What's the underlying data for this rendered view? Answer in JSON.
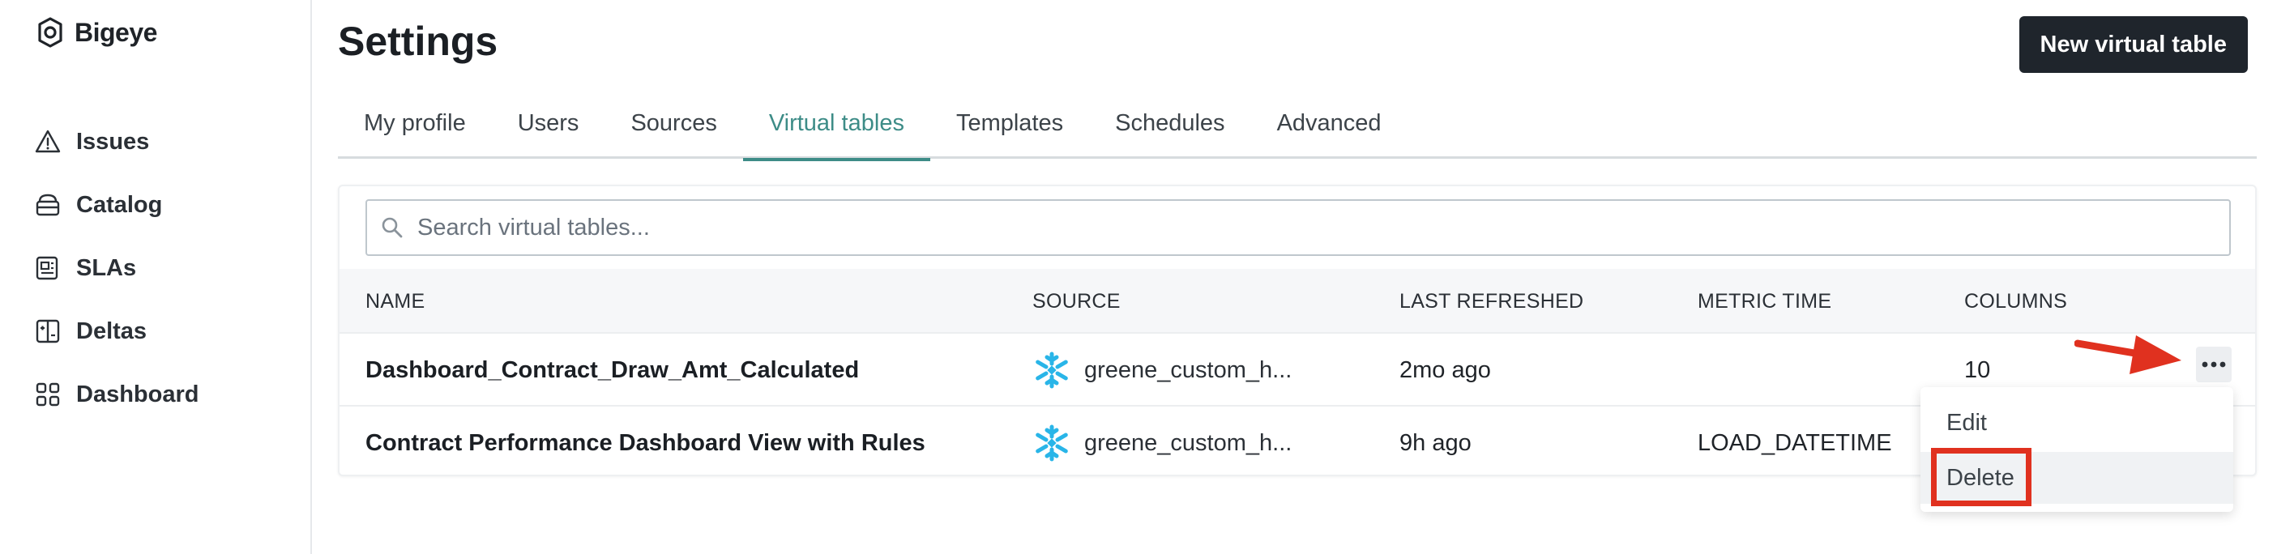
{
  "app": {
    "name": "Bigeye"
  },
  "sidebar": {
    "items": [
      {
        "label": "Issues",
        "icon": "warning-triangle-icon"
      },
      {
        "label": "Catalog",
        "icon": "database-icon"
      },
      {
        "label": "SLAs",
        "icon": "sla-document-icon"
      },
      {
        "label": "Deltas",
        "icon": "deltas-icon"
      },
      {
        "label": "Dashboard",
        "icon": "dashboard-grid-icon"
      }
    ]
  },
  "page": {
    "title": "Settings",
    "primary_action": "New virtual table"
  },
  "tabs": [
    {
      "label": "My profile"
    },
    {
      "label": "Users"
    },
    {
      "label": "Sources"
    },
    {
      "label": "Virtual tables",
      "active": true
    },
    {
      "label": "Templates"
    },
    {
      "label": "Schedules"
    },
    {
      "label": "Advanced"
    }
  ],
  "search": {
    "placeholder": "Search virtual tables...",
    "value": ""
  },
  "table": {
    "columns": [
      "NAME",
      "SOURCE",
      "LAST REFRESHED",
      "METRIC TIME",
      "COLUMNS"
    ],
    "rows": [
      {
        "name": "Dashboard_Contract_Draw_Amt_Calculated",
        "source": "greene_custom_h...",
        "source_icon": "snowflake-icon",
        "last_refreshed": "2mo ago",
        "metric_time": "",
        "columns": "10"
      },
      {
        "name": "Contract Performance Dashboard View with Rules",
        "source": "greene_custom_h...",
        "source_icon": "snowflake-icon",
        "last_refreshed": "9h ago",
        "metric_time": "LOAD_DATETIME",
        "columns": ""
      }
    ]
  },
  "context_menu": {
    "items": [
      {
        "label": "Edit"
      },
      {
        "label": "Delete",
        "hovered": true
      }
    ]
  },
  "colors": {
    "accent": "#3d8c87",
    "annotation": "#e0311f",
    "primary_button": "#1f252c",
    "snowflake": "#29b5e8"
  }
}
